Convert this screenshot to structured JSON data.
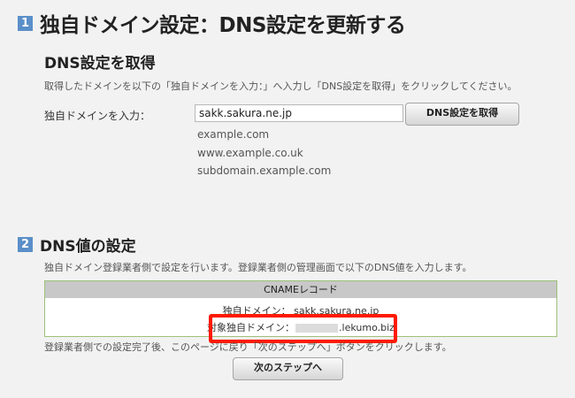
{
  "section1": {
    "number": "1",
    "title": "独自ドメイン設定：DNS設定を更新する",
    "subtitle": "DNS設定を取得",
    "description": "取得したドメインを以下の「独自ドメインを入力：」へ入力し「DNS設定を取得」をクリックしてください。",
    "field_label": "独自ドメインを入力：",
    "input_value": "sakk.sakura.ne.jp",
    "button_label": "DNS設定を取得",
    "examples": [
      "example.com",
      "www.example.co.uk",
      "subdomain.example.com"
    ]
  },
  "section2": {
    "number": "2",
    "title": "DNS値の設定",
    "description": "独自ドメイン登録業者側で設定を行います。登録業者側の管理画面で以下のDNS値を入力します。",
    "table_header": "CNAMEレコード",
    "row1": "独自ドメイン： sakk.sakura.ne.jp",
    "row2_label": "対象独自ドメイン：",
    "row2_value": ".lekumo.biz",
    "after_text": "登録業者側での設定完了後、このページに戻り「次のステップへ」ボタンをクリックします。",
    "next_button": "次のステップへ"
  },
  "colors": {
    "step_badge": "#5b8fc9",
    "table_border": "#9dc07a",
    "highlight": "#ff1a00"
  }
}
